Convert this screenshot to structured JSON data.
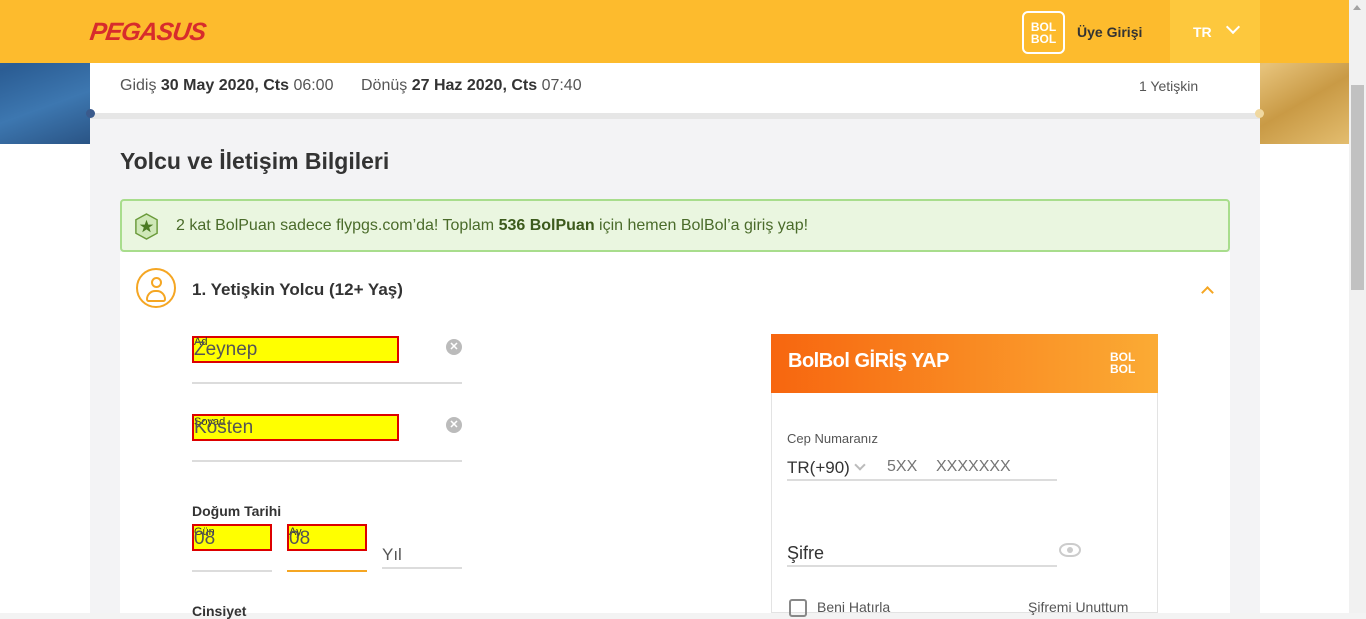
{
  "header": {
    "logo": "PEGASUS",
    "bolbol_badge_top": "BOL",
    "bolbol_badge_bottom": "BOL",
    "login_label": "Üye Girişi",
    "language": "TR"
  },
  "summary": {
    "outbound_prefix": "Gidiş",
    "outbound_date": "30 May 2020, Cts",
    "outbound_time": "06:00",
    "return_prefix": "Dönüş",
    "return_date": "27 Haz 2020, Cts",
    "return_time": "07:40",
    "passengers": "1 Yetişkin"
  },
  "section_title": "Yolcu ve İletişim Bilgileri",
  "promo": {
    "text_before": "2 kat BolPuan sadece flypgs.com’da! Toplam ",
    "points": "536 BolPuan",
    "text_after": " için hemen BolBol’a giriş yap!"
  },
  "passenger": {
    "title": "1. Yetişkin Yolcu (12+ Yaş)",
    "first_name_label": "Ad",
    "first_name_value": "Zeynep",
    "last_name_label": "Soyad",
    "last_name_value": "Kösten",
    "dob_label": "Doğum Tarihi",
    "day_label": "Gün",
    "day_value": "08",
    "month_label": "Ay",
    "month_value": "08",
    "year_label": "Yıl",
    "gender_label": "Cinsiyet"
  },
  "bolbol_login": {
    "title": "BolBol GİRİŞ YAP",
    "logo_top": "BOL",
    "logo_bottom": "BOL",
    "phone_label": "Cep Numaranız",
    "country_code": "TR(+90)",
    "prefix_placeholder": "5XX",
    "number_placeholder": "XXXXXXX",
    "password_label": "Şifre",
    "remember_label": "Beni Hatırla",
    "forgot_label": "Şifremi Unuttum"
  },
  "colors": {
    "header": "#fdbb2d",
    "brand_red": "#d72c2c",
    "accent_orange": "#f5a623",
    "highlight": "#ffff00",
    "promo_bg": "#eaf6e0"
  }
}
